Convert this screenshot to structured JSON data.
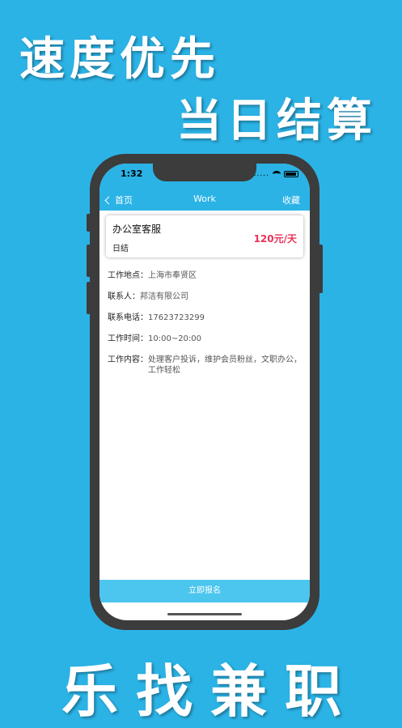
{
  "promo": {
    "line1": "速度优先",
    "line2": "当日结算",
    "line3": "乐找兼职"
  },
  "status": {
    "time": "1:32",
    "signal_dots": "....."
  },
  "nav": {
    "back_label": "首页",
    "title": "Work",
    "favorite_label": "收藏"
  },
  "job": {
    "title": "办公室客服",
    "settlement": "日结",
    "pay": "120元/天"
  },
  "details": [
    {
      "label": "工作地点：",
      "value": "上海市奉贤区"
    },
    {
      "label": "联系人：",
      "value": "邦洁有限公司"
    },
    {
      "label": "联系电话：",
      "value": "17623723299"
    },
    {
      "label": "工作时间：",
      "value": "10:00~20:00"
    },
    {
      "label": "工作内容：",
      "value": "处理客户投诉，维护会员粉丝，文职办公，工作轻松"
    }
  ],
  "apply_button": "立即报名",
  "colors": {
    "background": "#2bb3e6",
    "price": "#e8345a",
    "apply": "#4cc6ef"
  }
}
